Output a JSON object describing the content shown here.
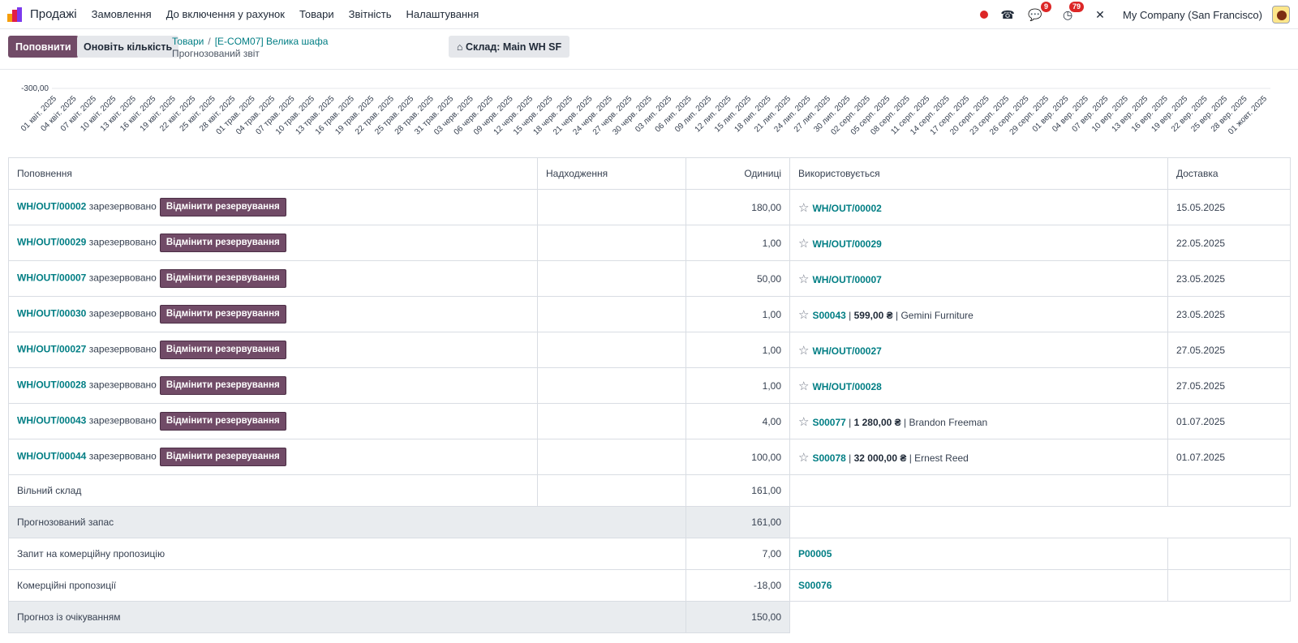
{
  "app": {
    "name": "Продажі",
    "menu": [
      "Замовлення",
      "До включення у рахунок",
      "Товари",
      "Звітність",
      "Налаштування"
    ],
    "chat_badge": "9",
    "activity_badge": "79",
    "company": "My Company (San Francisco)"
  },
  "control": {
    "replenish_label": "Поповнити",
    "update_qty_label": "Оновіть кількість",
    "breadcrumb_root": "Товари",
    "breadcrumb_item": "[E-COM07] Велика шафа",
    "subtitle": "Прогнозований звіт",
    "warehouse_label": "Склад: Main WH SF"
  },
  "chart_data": {
    "type": "line",
    "y_tick": "-300,00",
    "x": [
      "01 квіт. 2025",
      "04 квіт. 2025",
      "07 квіт. 2025",
      "10 квіт. 2025",
      "13 квіт. 2025",
      "16 квіт. 2025",
      "19 квіт. 2025",
      "22 квіт. 2025",
      "25 квіт. 2025",
      "28 квіт. 2025",
      "01 трав. 2025",
      "04 трав. 2025",
      "07 трав. 2025",
      "10 трав. 2025",
      "13 трав. 2025",
      "16 трав. 2025",
      "19 трав. 2025",
      "22 трав. 2025",
      "25 трав. 2025",
      "28 трав. 2025",
      "31 трав. 2025",
      "03 черв. 2025",
      "06 черв. 2025",
      "09 черв. 2025",
      "12 черв. 2025",
      "15 черв. 2025",
      "18 черв. 2025",
      "21 черв. 2025",
      "24 черв. 2025",
      "27 черв. 2025",
      "30 черв. 2025",
      "03 лип. 2025",
      "06 лип. 2025",
      "09 лип. 2025",
      "12 лип. 2025",
      "15 лип. 2025",
      "18 лип. 2025",
      "21 лип. 2025",
      "24 лип. 2025",
      "27 лип. 2025",
      "30 лип. 2025",
      "02 серп. 2025",
      "05 серп. 2025",
      "08 серп. 2025",
      "11 серп. 2025",
      "14 серп. 2025",
      "17 серп. 2025",
      "20 серп. 2025",
      "23 серп. 2025",
      "26 серп. 2025",
      "29 серп. 2025",
      "01 вер. 2025",
      "04 вер. 2025",
      "07 вер. 2025",
      "10 вер. 2025",
      "13 вер. 2025",
      "16 вер. 2025",
      "19 вер. 2025",
      "22 вер. 2025",
      "25 вер. 2025",
      "28 вер. 2025",
      "01 жовт. 2025"
    ]
  },
  "table": {
    "headers": {
      "replenishment": "Поповнення",
      "receipt": "Надходження",
      "units": "Одиниці",
      "used_by": "Використовується",
      "delivery": "Доставка"
    },
    "reserved_text": "зарезервовано",
    "unreserve_label": "Відмінити резервування",
    "rows": [
      {
        "ref": "WH/OUT/00002",
        "units": "180,00",
        "used": "WH/OUT/00002",
        "extra_amount": "",
        "extra_partner": "",
        "date": "15.05.2025"
      },
      {
        "ref": "WH/OUT/00029",
        "units": "1,00",
        "used": "WH/OUT/00029",
        "extra_amount": "",
        "extra_partner": "",
        "date": "22.05.2025"
      },
      {
        "ref": "WH/OUT/00007",
        "units": "50,00",
        "used": "WH/OUT/00007",
        "extra_amount": "",
        "extra_partner": "",
        "date": "23.05.2025"
      },
      {
        "ref": "WH/OUT/00030",
        "units": "1,00",
        "used": "S00043",
        "extra_amount": "599,00 ₴",
        "extra_partner": "Gemini Furniture",
        "date": "23.05.2025"
      },
      {
        "ref": "WH/OUT/00027",
        "units": "1,00",
        "used": "WH/OUT/00027",
        "extra_amount": "",
        "extra_partner": "",
        "date": "27.05.2025"
      },
      {
        "ref": "WH/OUT/00028",
        "units": "1,00",
        "used": "WH/OUT/00028",
        "extra_amount": "",
        "extra_partner": "",
        "date": "27.05.2025"
      },
      {
        "ref": "WH/OUT/00043",
        "units": "4,00",
        "used": "S00077",
        "extra_amount": "1 280,00 ₴",
        "extra_partner": "Brandon Freeman",
        "date": "01.07.2025"
      },
      {
        "ref": "WH/OUT/00044",
        "units": "100,00",
        "used": "S00078",
        "extra_amount": "32 000,00 ₴",
        "extra_partner": "Ernest Reed",
        "date": "01.07.2025"
      }
    ],
    "summary": {
      "free_stock_label": "Вільний склад",
      "free_stock_value": "161,00",
      "forecast_label": "Прогнозований запас",
      "forecast_value": "161,00",
      "rfq_label": "Запит на комерційну пропозицію",
      "rfq_value": "7,00",
      "rfq_ref": "P00005",
      "quotes_label": "Комерційні пропозиції",
      "quotes_value": "-18,00",
      "quotes_ref": "S00076",
      "pending_label": "Прогноз із очікуванням",
      "pending_value": "150,00"
    }
  }
}
